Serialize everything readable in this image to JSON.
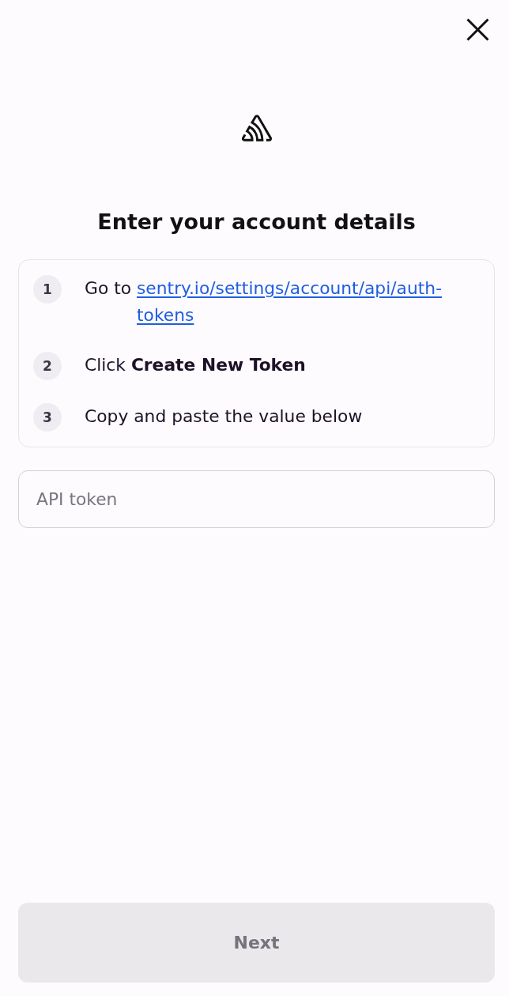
{
  "title": "Enter your account details",
  "steps": [
    {
      "number": "1",
      "text": "Go to",
      "link": "sentry.io/settings/account/api/auth-tokens"
    },
    {
      "number": "2",
      "text": "Click **Create New Token**"
    },
    {
      "number": "3",
      "text": "Copy and paste the value below"
    }
  ],
  "token_field": {
    "placeholder": "API token"
  },
  "next_button": {
    "label": "Next",
    "disabled": true
  }
}
